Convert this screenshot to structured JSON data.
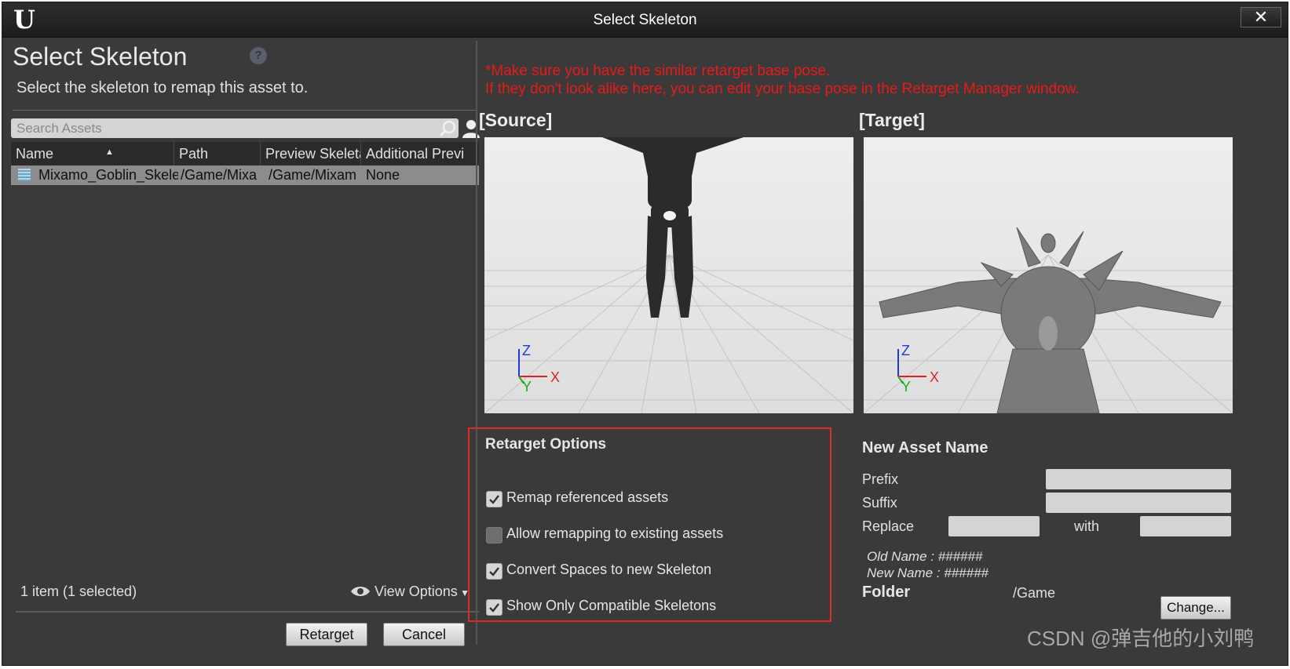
{
  "window": {
    "title": "Select Skeleton",
    "close_label": "✕"
  },
  "left": {
    "heading": "Select Skeleton",
    "subheading": "Select the skeleton to remap this asset to.",
    "search": {
      "placeholder": "Search Assets"
    },
    "columns": [
      "Name",
      "Path",
      "Preview Skeleta",
      "Additional Previ"
    ],
    "rows": [
      {
        "name": "Mixamo_Goblin_Skelet",
        "path": "/Game/Mixa",
        "preview": "/Game/Mixam",
        "additional": "None"
      }
    ],
    "status": "1 item (1 selected)",
    "view_options": "View Options",
    "retarget_label": "Retarget",
    "cancel_label": "Cancel"
  },
  "right": {
    "warning_line1": "*Make sure you have the similar retarget base pose.",
    "warning_line2": "If they don't look alike here, you can edit your base pose in the Retarget Manager window.",
    "source_label": "[Source]",
    "target_label": "[Target]",
    "axis": {
      "z": "Z",
      "y": "Y",
      "x": "X"
    },
    "options": {
      "title": "Retarget Options",
      "items": [
        {
          "label": "Remap referenced assets",
          "checked": true
        },
        {
          "label": "Allow remapping to existing assets",
          "checked": false
        },
        {
          "label": "Convert Spaces to new Skeleton",
          "checked": true
        },
        {
          "label": "Show Only Compatible Skeletons",
          "checked": true
        }
      ]
    },
    "new_asset": {
      "title": "New Asset Name",
      "prefix_label": "Prefix",
      "suffix_label": "Suffix",
      "replace_label": "Replace",
      "with_label": "with",
      "old_name": "Old Name : ######",
      "new_name": "New Name : ######"
    },
    "folder": {
      "label": "Folder",
      "value": "/Game",
      "change_label": "Change..."
    }
  },
  "watermark": "CSDN @弹吉他的小刘鸭",
  "colors": {
    "accent_red": "#e02a2a",
    "panel_bg": "#3a3a3a",
    "selected_row": "#8c8c8c"
  }
}
